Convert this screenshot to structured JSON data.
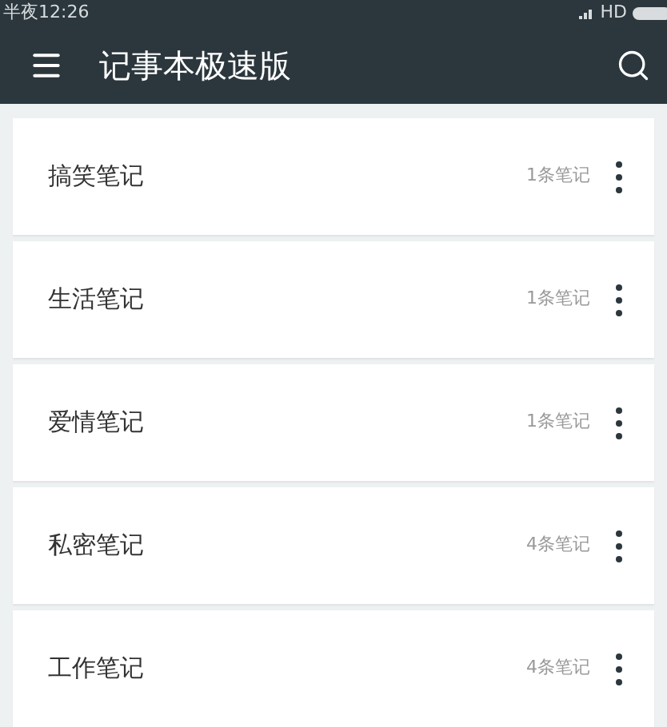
{
  "status_bar": {
    "time": "半夜12:26",
    "network": "HD"
  },
  "toolbar": {
    "title": "记事本极速版"
  },
  "notebooks": [
    {
      "name": "搞笑笔记",
      "count": "1条笔记"
    },
    {
      "name": "生活笔记",
      "count": "1条笔记"
    },
    {
      "name": "爱情笔记",
      "count": "1条笔记"
    },
    {
      "name": "私密笔记",
      "count": "4条笔记"
    },
    {
      "name": "工作笔记",
      "count": "4条笔记"
    }
  ]
}
